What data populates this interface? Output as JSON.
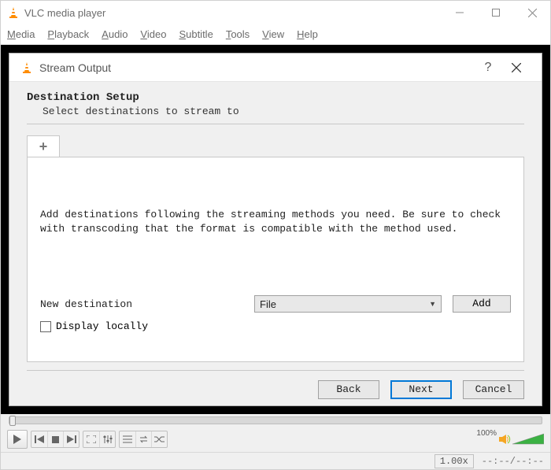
{
  "titlebar": {
    "title": "VLC media player"
  },
  "menubar": [
    "Media",
    "Playback",
    "Audio",
    "Video",
    "Subtitle",
    "Tools",
    "View",
    "Help"
  ],
  "dialog": {
    "title": "Stream Output",
    "section_title": "Destination Setup",
    "section_sub": "Select destinations to stream to",
    "tab_plus": "+",
    "desc": "Add destinations following the streaming methods you need. Be sure to check with transcoding that the format is compatible with the method used.",
    "new_dest_label": "New destination",
    "new_dest_value": "File",
    "add_btn": "Add",
    "display_locally": "Display locally",
    "back": "Back",
    "next": "Next",
    "cancel": "Cancel"
  },
  "bottom": {
    "volume_pct": "100%",
    "speed": "1.00x",
    "time": "--:--/--:--"
  }
}
